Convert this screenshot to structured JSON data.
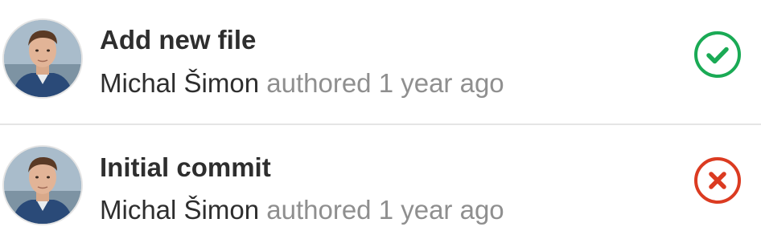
{
  "commits": [
    {
      "title": "Add new file",
      "author": "Michal Šimon",
      "authored": "authored",
      "time": "1 year ago",
      "status": "success",
      "status_icon": "check-circle-icon",
      "status_color": "#1aaa55"
    },
    {
      "title": "Initial commit",
      "author": "Michal Šimon",
      "authored": "authored",
      "time": "1 year ago",
      "status": "failed",
      "status_icon": "x-circle-icon",
      "status_color": "#db3b21"
    }
  ]
}
